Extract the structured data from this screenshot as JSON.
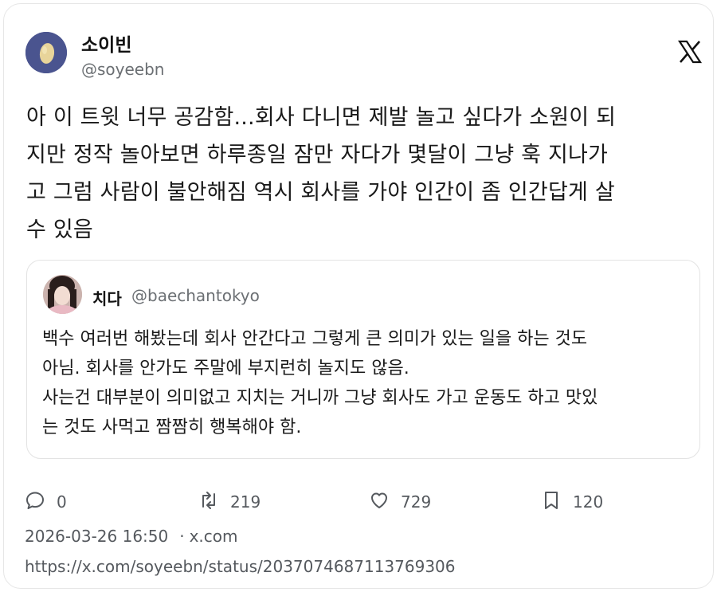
{
  "post": {
    "author_name": "소이빈",
    "author_handle": "@soyeebn",
    "platform_icon": "x-logo-icon",
    "text_lines": [
      "아 이 트윗 너무 공감함...회사 다니면 제발 놀고 싶다가 소원이 되",
      "지만 정작 놀아보면 하루종일 잠만 자다가 몇달이 그냥 훅 지나가",
      "고 그럼 사람이 불안해짐 역시 회사를 가야 인간이 좀 인간답게 살",
      "수 있음"
    ]
  },
  "quote": {
    "author_name": "치다",
    "author_handle": "@baechantokyo",
    "text_lines": [
      "백수 여러번 해봤는데 회사 안간다고 그렇게 큰 의미가 있는 일을 하는 것도",
      "아님. 회사를 안가도 주말에 부지런히 놀지도 않음.",
      "사는건 대부분이 의미없고 지치는 거니까 그냥 회사도 가고 운동도 하고 맛있",
      "는 것도 사먹고 짬짬히 행복해야 함."
    ]
  },
  "actions": {
    "replies": "0",
    "reposts": "219",
    "likes": "729",
    "bookmarks": "120"
  },
  "meta": {
    "timestamp": "2026-03-26 16:50",
    "separator": "·",
    "source": "x.com",
    "url": "https://x.com/soyeebn/status/2037074687113769306"
  },
  "colors": {
    "avatar_bg": "#4a548f",
    "muted_text": "#55595e",
    "border": "#e3e3e3"
  }
}
